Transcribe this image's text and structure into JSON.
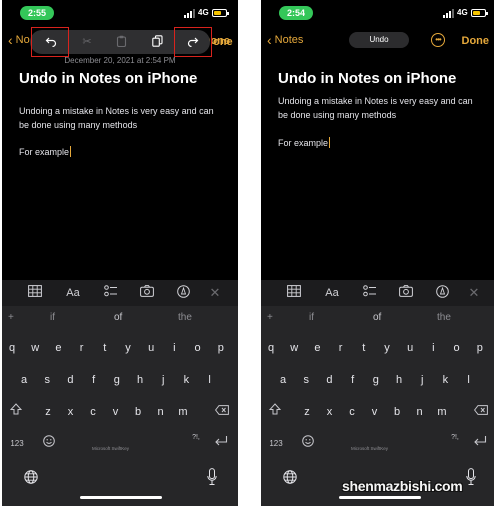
{
  "left": {
    "status": {
      "time": "2:55",
      "network": "4G",
      "battery_level": 0.6
    },
    "nav": {
      "back_label": "No",
      "done_label": "Done"
    },
    "toolbar": {
      "icons": [
        "undo-icon",
        "cut-icon",
        "paste-icon",
        "copy-icon",
        "redo-icon"
      ],
      "enabled": [
        true,
        false,
        false,
        true,
        true
      ]
    },
    "date_line": "December 20, 2021 at 2:54 PM",
    "note": {
      "title": "Undo in Notes on iPhone",
      "body": "Undoing a mistake in Notes is very easy and can be done using many methods",
      "example": "For example"
    }
  },
  "right": {
    "status": {
      "time": "2:54",
      "network": "4G",
      "battery_level": 0.6
    },
    "nav": {
      "back_label": "Notes",
      "undo_label": "Undo",
      "done_label": "Done"
    },
    "note": {
      "title": "Undo in Notes on iPhone",
      "body": "Undoing a mistake in Notes is very easy and can be done using many methods",
      "example": "For example"
    }
  },
  "keyboard": {
    "suggestions": {
      "plus": "+",
      "left": "if",
      "middle": "of",
      "right": "the"
    },
    "row1": [
      "q",
      "w",
      "e",
      "r",
      "t",
      "y",
      "u",
      "i",
      "o",
      "p"
    ],
    "row2": [
      "a",
      "s",
      "d",
      "f",
      "g",
      "h",
      "j",
      "k",
      "l"
    ],
    "row3": [
      "z",
      "x",
      "c",
      "v",
      "b",
      "n",
      "m"
    ],
    "numbers_key": "123",
    "punct_key": "?!,",
    "brand": "Microsoft SwiftKey"
  },
  "watermark": "shenmazbishi.com",
  "colors": {
    "accent": "#e5a83b",
    "status_green": "#34c759",
    "highlight_red": "#d9231d"
  }
}
